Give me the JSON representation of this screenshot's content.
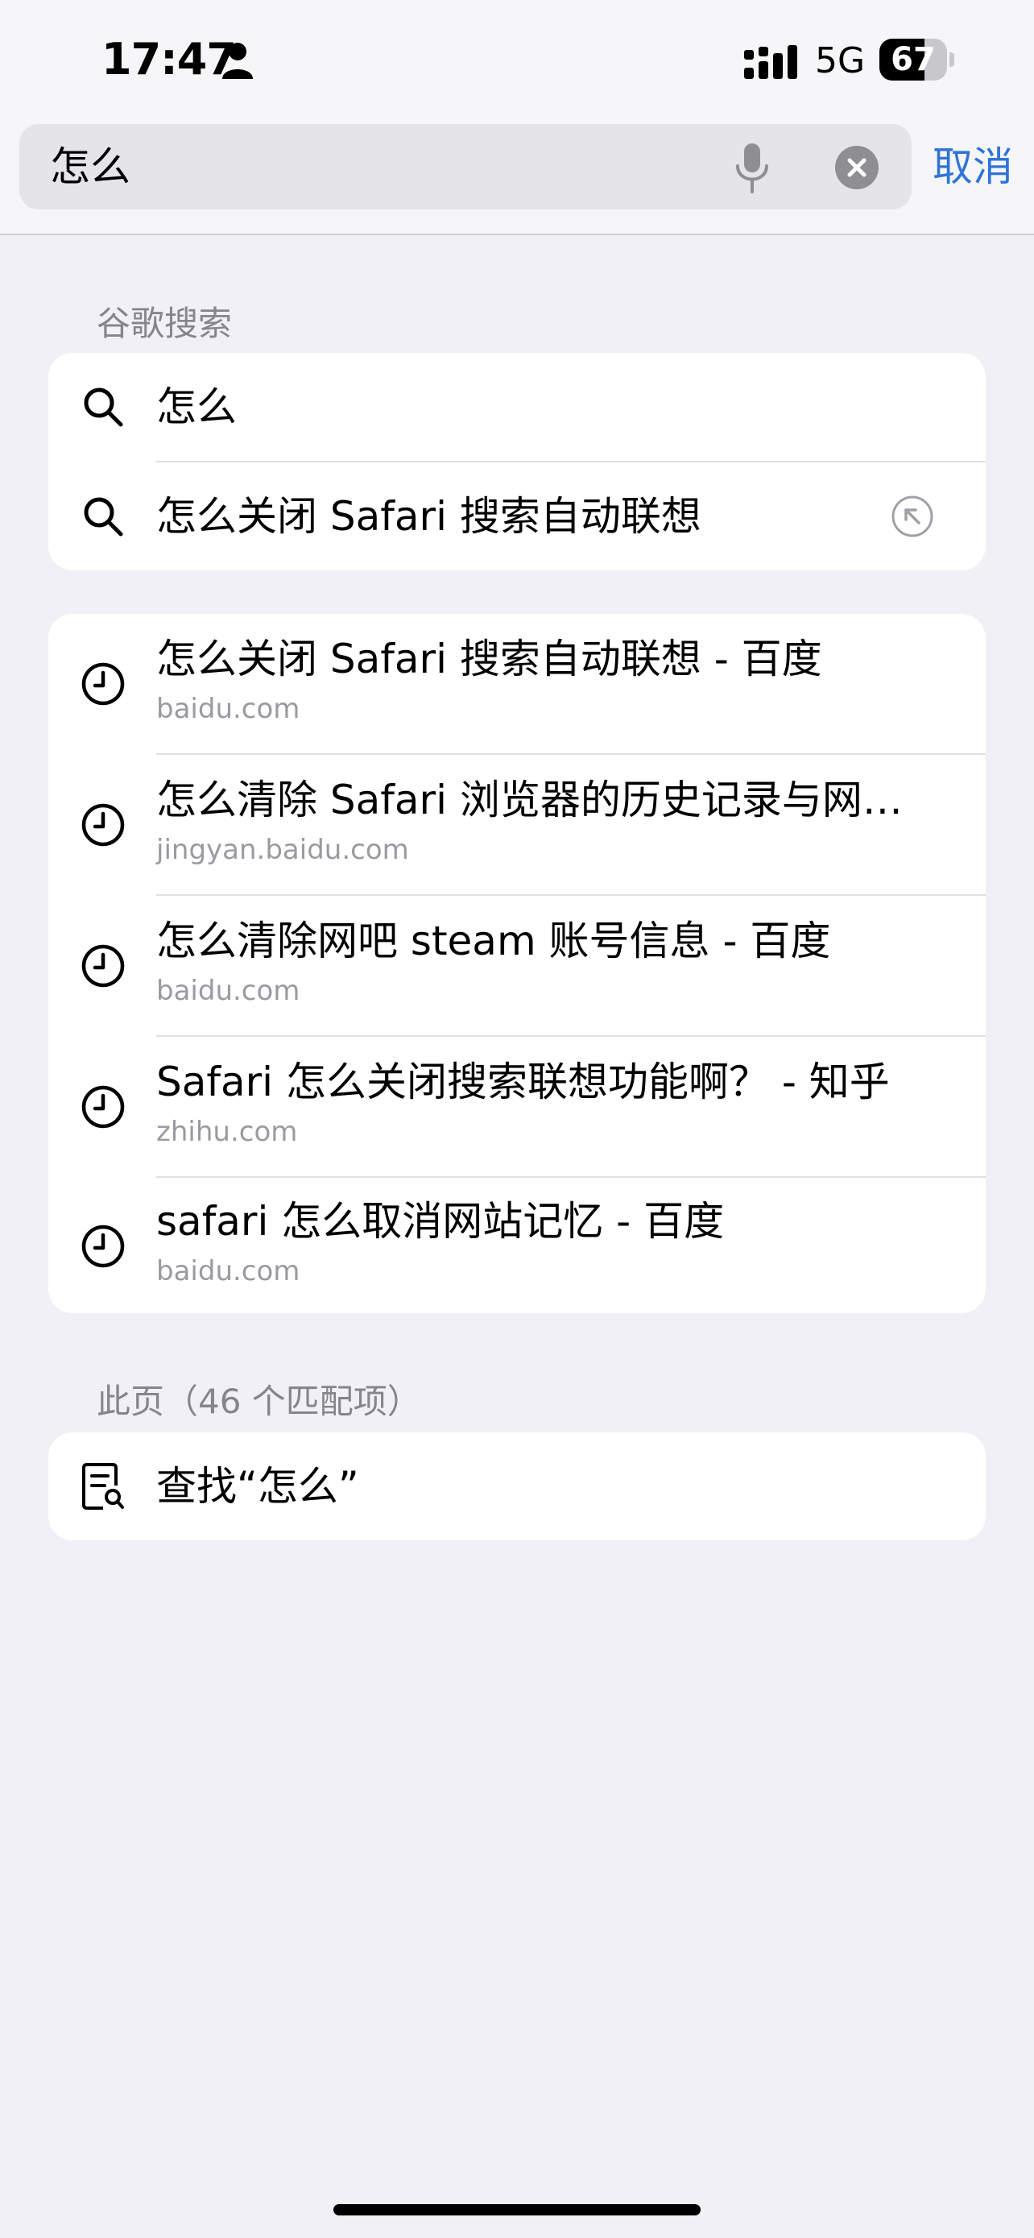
{
  "status_bar": {
    "time": "17:47",
    "network": "5G",
    "battery": "67",
    "battery_level": 0.67
  },
  "search": {
    "query": "怎么",
    "cancel_label": "取消"
  },
  "google_section": {
    "header": "谷歌搜索",
    "items": [
      {
        "text": "怎么"
      },
      {
        "text": "怎么关闭 Safari 搜索自动联想"
      }
    ]
  },
  "history": {
    "items": [
      {
        "title": "怎么关闭 Safari 搜索自动联想 - 百度",
        "url": "baidu.com"
      },
      {
        "title": "怎么清除 Safari 浏览器的历史记录与网…",
        "url": "jingyan.baidu.com"
      },
      {
        "title": "怎么清除网吧 steam 账号信息 - 百度",
        "url": "baidu.com"
      },
      {
        "title": "Safari 怎么关闭搜索联想功能啊？ - 知乎",
        "url": "zhihu.com"
      },
      {
        "title": "safari 怎么取消网站记忆 - 百度",
        "url": "baidu.com"
      }
    ]
  },
  "page_section": {
    "header": "此页（46 个匹配项）",
    "find_label": "查找“怎么”"
  },
  "colors": {
    "accent": "#2F74D6",
    "background": "#F0F0F6",
    "secondary_text": "#85858B"
  },
  "icons": [
    "person-icon",
    "signal-icon",
    "battery-icon",
    "mic-icon",
    "clear-icon",
    "search-icon",
    "arrow-up-left-icon",
    "clock-icon",
    "find-in-page-icon"
  ]
}
